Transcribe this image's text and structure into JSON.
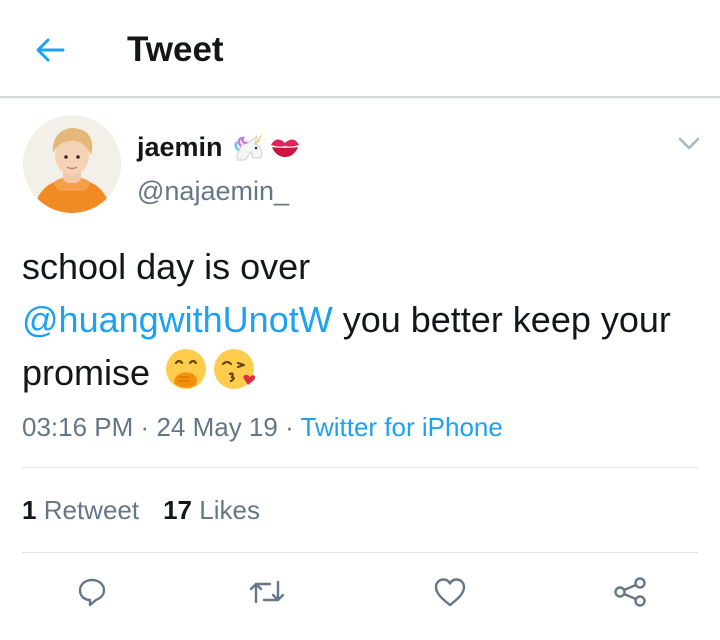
{
  "header": {
    "title": "Tweet",
    "back_icon": "arrow-left-icon"
  },
  "author": {
    "name": "jaemin",
    "handle": "@najaemin_",
    "name_emojis": [
      "unicorn-icon",
      "kiss-mark-icon"
    ]
  },
  "tweet": {
    "line1": "school day is over",
    "mention": "@huangwithUnotW",
    "rest": " you better keep your promise",
    "emojis": [
      "face-with-hand-over-mouth-icon",
      "face-blowing-kiss-icon"
    ]
  },
  "meta": {
    "time": "03:16 PM",
    "sep1": "·",
    "date": "24 May 19",
    "sep2": "·",
    "source": "Twitter for iPhone"
  },
  "stats": {
    "retweets_count": "1",
    "retweets_label": "Retweet",
    "likes_count": "17",
    "likes_label": "Likes"
  },
  "actions": [
    "reply-icon",
    "retweet-icon",
    "like-icon",
    "share-icon"
  ],
  "colors": {
    "accent": "#1da1f2",
    "text": "#14171a",
    "secondary": "#657786",
    "divider": "#dfe3e6"
  }
}
